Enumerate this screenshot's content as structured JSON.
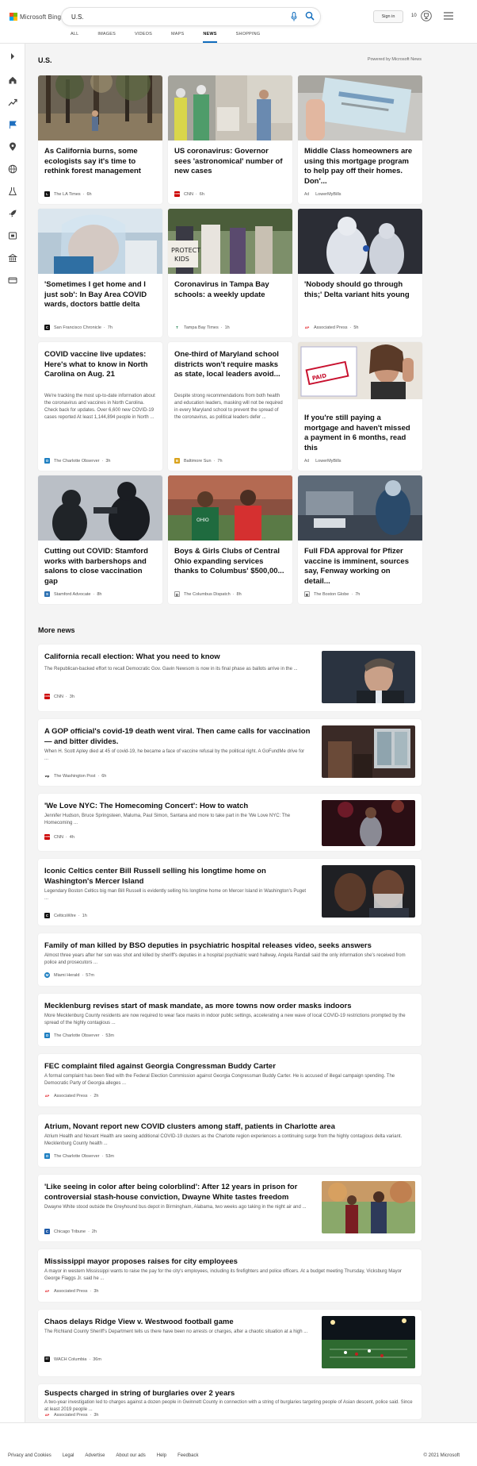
{
  "header": {
    "brand": "Microsoft Bing",
    "search_value": "U.S.",
    "tabs": [
      "ALL",
      "IMAGES",
      "VIDEOS",
      "MAPS",
      "NEWS",
      "SHOPPING"
    ],
    "active_tab": "NEWS",
    "signin_label": "Sign in",
    "rewards_count": "10"
  },
  "section": {
    "title": "U.S.",
    "powered_by": "Powered by Microsoft News"
  },
  "cards": [
    {
      "title": "As California burns, some ecologists say it's time to rethink forest management",
      "source": "The LA Times",
      "time": "6h",
      "badge": "L",
      "badge_color": "#111111"
    },
    {
      "title": "US coronavirus: Governor sees 'astronomical' number of new cases",
      "source": "CNN",
      "time": "6h",
      "badge": "CNN",
      "badge_color": "#cc0000"
    },
    {
      "title": "Middle Class homeowners are using this mortgage program to help pay off their homes. Don'...",
      "source": "LowerMyBills",
      "ad": "Ad"
    },
    {
      "title": "'Sometimes I get home and I just sob': In Bay Area COVID wards, doctors battle delta",
      "source": "San Francisco Chronicle",
      "time": "7h",
      "badge": "C",
      "badge_color": "#111111"
    },
    {
      "title": "Coronavirus in Tampa Bay schools: a weekly update",
      "source": "Tampa Bay Times",
      "time": "1h",
      "badge": "T",
      "badge_color": "#1a7f4b"
    },
    {
      "title": "'Nobody should go through this;' Delta variant hits young",
      "source": "Associated Press",
      "time": "5h",
      "badge": "AP",
      "badge_color": "#e21b22"
    },
    {
      "title": "COVID vaccine live updates: Here's what to know in North Carolina on Aug. 21",
      "desc": "We're tracking the most up-to-date information about the coronavirus and vaccines in North Carolina. Check back for updates. Over 6,600 new COVID-19 cases reported At least 1,144,894 people in North ...",
      "source": "The Charlotte Observer",
      "time": "3h",
      "badge": "O",
      "badge_color": "#1e7fc1"
    },
    {
      "title": "One-third of Maryland school districts won't require masks as state, local leaders avoid...",
      "desc": "Despite strong recommendations from both health and education leaders, masking will not be required in every Maryland school to prevent the spread of the coronavirus, as political leaders defer ...",
      "source": "Baltimore Sun",
      "time": "7h",
      "badge": "B",
      "badge_color": "#d9a21b"
    },
    {
      "title": "If you're still paying a mortgage and haven't missed a payment in 6 months, read this",
      "source": "LowerMyBills",
      "ad": "Ad"
    },
    {
      "title": "Cutting out COVID: Stamford works with barbershops and salons to close vaccination gap",
      "source": "Stamford Advocate",
      "time": "8h",
      "badge": "S",
      "badge_color": "#2a6fb0"
    },
    {
      "title": "Boys & Girls Clubs of Central Ohio expanding services thanks to Columbus' $500,00...",
      "source": "The Columbus Dispatch",
      "time": "8h",
      "badge": "D",
      "badge_color": "#ffffff"
    },
    {
      "title": "Full FDA approval for Pfizer vaccine is imminent, sources say, Fenway working on detail...",
      "source": "The Boston Globe",
      "time": "7h",
      "badge": "B",
      "badge_color": "#ffffff"
    }
  ],
  "more_news": {
    "title": "More news",
    "items": [
      {
        "title": "California recall election: What you need to know",
        "desc": "The Republican-backed effort to recall Democratic Gov. Gavin Newsom is now in its final phase as ballots arrive in the ...",
        "source": "CNN",
        "time": "3h",
        "badge": "CNN",
        "badge_color": "#cc0000"
      },
      {
        "title": "A GOP official's covid-19 death went viral. Then came calls for vaccination — and bitter divides.",
        "desc": "When H. Scott Apley died at 45 of covid-19, he became a face of vaccine refusal by the political right. A GoFundMe drive for ...",
        "source": "The Washington Post",
        "time": "6h",
        "badge": "wp",
        "badge_color": "#ffffff"
      },
      {
        "title": "'We Love NYC: The Homecoming Concert': How to watch",
        "desc": "Jennifer Hudson, Bruce Springsteen, Maluma, Paul Simon, Santana and more to take part in the 'We Love NYC: The Homecoming ...",
        "source": "CNN",
        "time": "4h",
        "badge": "CNN",
        "badge_color": "#cc0000"
      },
      {
        "title": "Iconic Celtics center Bill Russell selling his longtime home on Washington's Mercer Island",
        "desc": "Legendary Boston Celtics big man Bill Russell is evidently selling his longtime home on Mercer Island in Washington's Puget ...",
        "source": "CelticsWire",
        "time": "1h",
        "badge": "C",
        "badge_color": "#111111"
      },
      {
        "title": "Family of man killed by BSO deputies in psychiatric hospital releases video, seeks answers",
        "desc": "Almost three years after her son was shot and killed by sheriff's deputies in a hospital psychiatric ward hallway, Angela Randall said the only information she's received from police and prosecutors ...",
        "source": "Miami Herald",
        "time": "57m",
        "badge": "M",
        "badge_color": "#1e7fc1"
      },
      {
        "title": "Mecklenburg revises start of mask mandate, as more towns now order masks indoors",
        "desc": "More Mecklenburg County residents are now required to wear face masks in indoor public settings, accelerating a new wave of local COVID-19 restrictions prompted by the spread of the highly contagious ...",
        "source": "The Charlotte Observer",
        "time": "53m",
        "badge": "O",
        "badge_color": "#1e7fc1"
      },
      {
        "title": "FEC complaint filed against Georgia Congressman Buddy Carter",
        "desc": "A formal complaint has been filed with the Federal Election Commission against Georgia Congressman Buddy Carter. He is accused of illegal campaign spending. The Democratic Party of Georgia alleges ...",
        "source": "Associated Press",
        "time": "2h",
        "badge": "AP",
        "badge_color": "#e21b22"
      },
      {
        "title": "Atrium, Novant report new COVID clusters among staff, patients in Charlotte area",
        "desc": "Atrium Health and Novant Health are seeing additional COVID-19 clusters as the Charlotte region experiences a continuing surge from the highly contagious delta variant. Mecklenburg County health ...",
        "source": "The Charlotte Observer",
        "time": "53m",
        "badge": "O",
        "badge_color": "#1e7fc1"
      },
      {
        "title": "'Like seeing in color after being colorblind': After 12 years in prison for controversial stash-house conviction, Dwayne White tastes freedom",
        "desc": "Dwayne White stood outside the Greyhound bus depot in Birmingham, Alabama, two weeks ago taking in the night air and ...",
        "source": "Chicago Tribune",
        "time": "2h",
        "badge": "C",
        "badge_color": "#1e5aa8"
      },
      {
        "title": "Mississippi mayor proposes raises for city employees",
        "desc": "A mayor in western Mississippi wants to raise the pay for the city's employees, including its firefighters and police officers. At a budget meeting Thursday, Vicksburg Mayor George Flaggs Jr. said he ...",
        "source": "Associated Press",
        "time": "3h",
        "badge": "AP",
        "badge_color": "#e21b22"
      },
      {
        "title": "Chaos delays Ridge View v. Westwood football game",
        "desc": "The Richland County Sheriff's Department tells us there have been no arrests or charges, after a chaotic situation at a high ...",
        "source": "WACH Columbia",
        "time": "36m",
        "badge": "57",
        "badge_color": "#111111"
      },
      {
        "title": "Suspects charged in string of burglaries over 2 years",
        "desc": "A two-year investigation led to charges against a dozen people in Gwinnett County in connection with a string of burglaries targeting people of Asian descent, police said. Since at least 2019 people ...",
        "source": "Associated Press",
        "time": "3h",
        "badge": "AP",
        "badge_color": "#e21b22"
      }
    ]
  },
  "footer": {
    "links": [
      "Privacy and Cookies",
      "Legal",
      "Advertise",
      "About our ads",
      "Help",
      "Feedback"
    ],
    "copyright": "© 2021 Microsoft"
  }
}
